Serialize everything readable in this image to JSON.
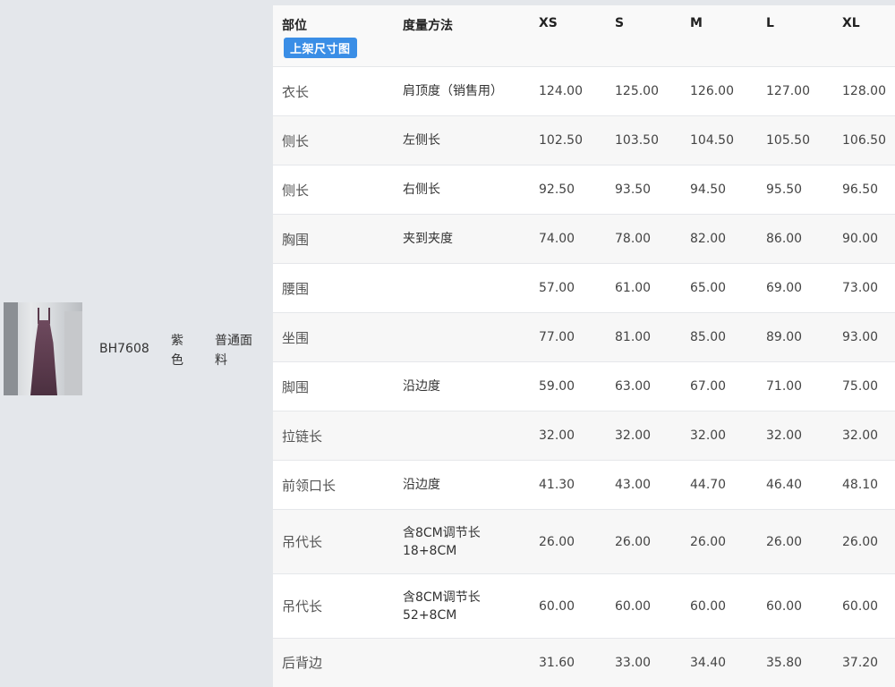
{
  "product": {
    "sku": "BH7608",
    "color": "紫色",
    "fabric": "普通面料"
  },
  "table": {
    "headers": [
      "部位",
      "度量方法",
      "XS",
      "S",
      "M",
      "L",
      "XL"
    ],
    "badge": "上架尺寸图",
    "rows": [
      {
        "part": "衣长",
        "method": "肩顶度（销售用）",
        "values": [
          "124.00",
          "125.00",
          "126.00",
          "127.00",
          "128.00"
        ]
      },
      {
        "part": "侧长",
        "method": "左侧长",
        "values": [
          "102.50",
          "103.50",
          "104.50",
          "105.50",
          "106.50"
        ]
      },
      {
        "part": "侧长",
        "method": "右侧长",
        "values": [
          "92.50",
          "93.50",
          "94.50",
          "95.50",
          "96.50"
        ]
      },
      {
        "part": "胸围",
        "method": "夹到夹度",
        "values": [
          "74.00",
          "78.00",
          "82.00",
          "86.00",
          "90.00"
        ]
      },
      {
        "part": "腰围",
        "method": "",
        "values": [
          "57.00",
          "61.00",
          "65.00",
          "69.00",
          "73.00"
        ]
      },
      {
        "part": "坐围",
        "method": "",
        "values": [
          "77.00",
          "81.00",
          "85.00",
          "89.00",
          "93.00"
        ]
      },
      {
        "part": "脚围",
        "method": "沿边度",
        "values": [
          "59.00",
          "63.00",
          "67.00",
          "71.00",
          "75.00"
        ]
      },
      {
        "part": "拉链长",
        "method": "",
        "values": [
          "32.00",
          "32.00",
          "32.00",
          "32.00",
          "32.00"
        ]
      },
      {
        "part": "前领口长",
        "method": "沿边度",
        "values": [
          "41.30",
          "43.00",
          "44.70",
          "46.40",
          "48.10"
        ]
      },
      {
        "part": "吊代长",
        "method": "含8CM调节长 18+8CM",
        "values": [
          "26.00",
          "26.00",
          "26.00",
          "26.00",
          "26.00"
        ]
      },
      {
        "part": "吊代长",
        "method": "含8CM调节长 52+8CM",
        "values": [
          "60.00",
          "60.00",
          "60.00",
          "60.00",
          "60.00"
        ]
      },
      {
        "part": "后背边",
        "method": "",
        "values": [
          "31.60",
          "33.00",
          "34.40",
          "35.80",
          "37.20"
        ]
      }
    ]
  }
}
